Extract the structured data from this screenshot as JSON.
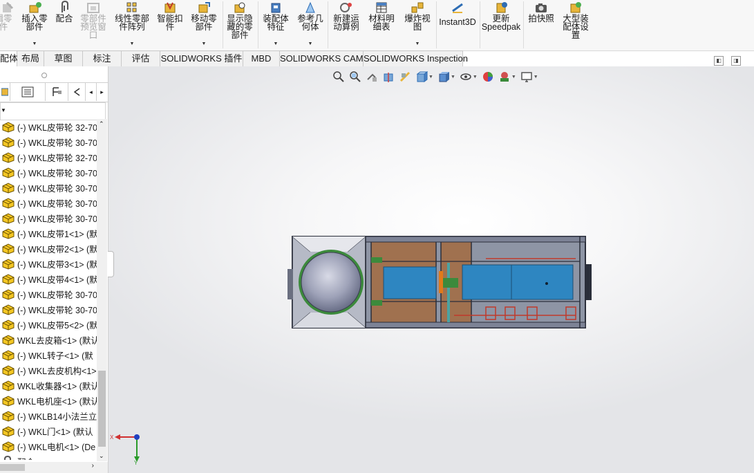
{
  "ribbon": {
    "items": [
      {
        "label": "辑零\n件",
        "icon": "edit-component-icon",
        "state": "disabled"
      },
      {
        "label": "插入零\n部件",
        "icon": "insert-components-icon"
      },
      {
        "label": "配合",
        "icon": "mate-icon"
      },
      {
        "label": "零部件\n预览窗\n口",
        "icon": "component-preview-window-icon",
        "state": "disabled"
      },
      {
        "label": "线性零部\n件阵列",
        "icon": "linear-component-pattern-icon"
      },
      {
        "label": "智能扣\n件",
        "icon": "smart-fasteners-icon"
      },
      {
        "label": "移动零\n部件",
        "icon": "move-component-icon"
      },
      {
        "label": "显示隐\n藏的零\n部件",
        "icon": "show-hidden-components-icon"
      },
      {
        "label": "装配体\n特征",
        "icon": "assembly-features-icon"
      },
      {
        "label": "参考几\n何体",
        "icon": "reference-geometry-icon"
      },
      {
        "label": "新建运\n动算例",
        "icon": "new-motion-study-icon"
      },
      {
        "label": "材料明\n细表",
        "icon": "bill-of-materials-icon"
      },
      {
        "label": "爆炸视\n图",
        "icon": "exploded-view-icon"
      },
      {
        "label": "Instant3D",
        "icon": "instant3d-icon"
      },
      {
        "label": "更新\nSpeedpak",
        "icon": "update-speedpak-icon"
      },
      {
        "label": "拍快照",
        "icon": "take-snapshot-icon"
      },
      {
        "label": "大型装\n配体设\n置",
        "icon": "large-assembly-settings-icon"
      }
    ]
  },
  "tabs": [
    {
      "label": "配体",
      "active": true
    },
    {
      "label": "布局"
    },
    {
      "label": "草图"
    },
    {
      "label": "标注"
    },
    {
      "label": "评估"
    },
    {
      "label": "SOLIDWORKS 插件"
    },
    {
      "label": "MBD"
    },
    {
      "label": "SOLIDWORKS CAM"
    },
    {
      "label": "SOLIDWORKS Inspection"
    }
  ],
  "feature_tree": {
    "items": [
      "(-) WKL皮带轮 32-70",
      "(-) WKL皮带轮 30-70",
      "(-) WKL皮带轮 32-70",
      "(-) WKL皮带轮 30-70",
      "(-) WKL皮带轮 30-70",
      "(-) WKL皮带轮 30-70",
      "(-) WKL皮带轮 30-70",
      "(-) WKL皮带1<1> (默",
      "(-) WKL皮带2<1> (默",
      "(-) WKL皮带3<1> (默",
      "(-) WKL皮带4<1> (默",
      "(-) WKL皮带轮 30-70",
      "(-) WKL皮带轮 30-70",
      "(-) WKL皮带5<2> (默",
      "WKL去皮箱<1> (默认",
      "(-) WKL转子<1> (默",
      "(-) WKL去皮机构<1>",
      "WKL收集器<1> (默认",
      "WKL电机座<1> (默认",
      "(-) WKLB14小法兰立",
      "(-) WKL门<1> (默认",
      "(-) WKL电机<1> (De",
      "配合"
    ]
  },
  "triad": {
    "x_label": "X",
    "y_label": "Y"
  },
  "colors": {
    "frame": "#5a5f7a",
    "blue_panel": "#2e86c1",
    "brown_panel": "#a0714f",
    "gray_panel": "#8e95a5",
    "green_parts": "#3c8a3c",
    "red_parts": "#c0392b"
  }
}
